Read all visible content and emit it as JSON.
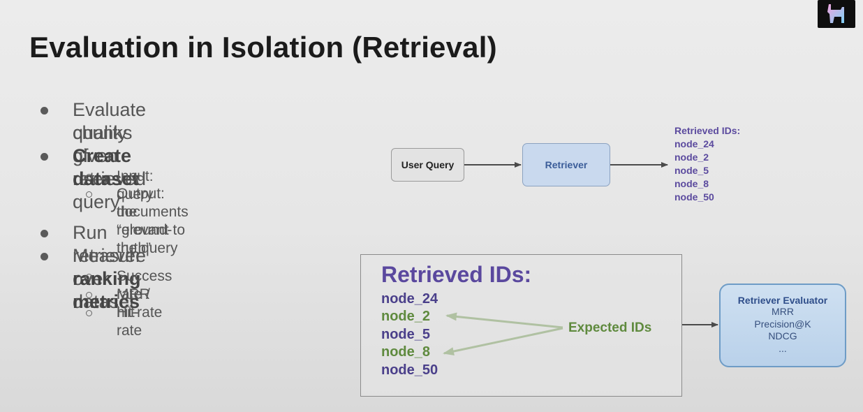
{
  "title": "Evaluation in Isolation (Retrieval)",
  "bullets": {
    "b1": "Evaluate quality of retrieved",
    "b1b": "chunks given user query",
    "b2": "Create dataset",
    "b2_sub1": "Input: query",
    "b2_sub2": "Output: the “ground-truth”",
    "b2_sub2b": "documents relevant to the query",
    "b3": "Run retriever over dataset",
    "b4_prefix": "Measure ",
    "b4_bold": "ranking metrics",
    "b4_sub1": "Success rate / hit-rate",
    "b4_sub2": "MRR",
    "b4_sub3": "Hit-rate"
  },
  "flow": {
    "user_query": "User Query",
    "retriever": "Retriever",
    "retrieved_title": "Retrieved IDs:",
    "ids": [
      "node_24",
      "node_2",
      "node_5",
      "node_8",
      "node_50"
    ]
  },
  "panel": {
    "title": "Retrieved IDs:",
    "ids": [
      "node_24",
      "node_2",
      "node_5",
      "node_8",
      "node_50"
    ],
    "expected_label": "Expected IDs"
  },
  "evaluator": {
    "title": "Retriever Evaluator",
    "metrics": [
      "MRR",
      "Precision@K",
      "NDCG",
      "..."
    ]
  },
  "colors": {
    "accent_purple": "#5a489e",
    "expected_green": "#5f8a3e",
    "retriever_blue": "#c9d9ee"
  }
}
